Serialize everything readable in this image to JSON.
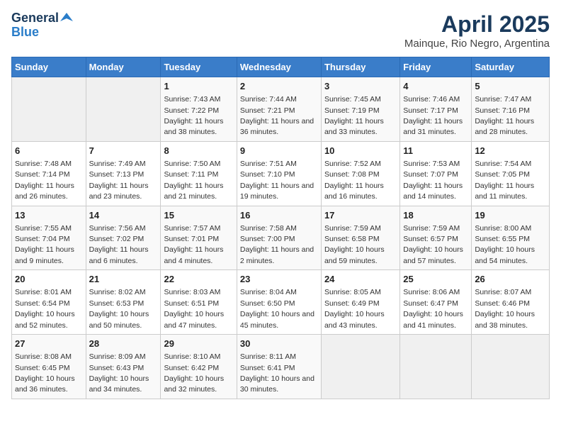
{
  "logo": {
    "general": "General",
    "blue": "Blue"
  },
  "title": "April 2025",
  "location": "Mainque, Rio Negro, Argentina",
  "weekdays": [
    "Sunday",
    "Monday",
    "Tuesday",
    "Wednesday",
    "Thursday",
    "Friday",
    "Saturday"
  ],
  "weeks": [
    [
      {
        "day": "",
        "info": "",
        "empty": true
      },
      {
        "day": "",
        "info": "",
        "empty": true
      },
      {
        "day": "1",
        "info": "Sunrise: 7:43 AM\nSunset: 7:22 PM\nDaylight: 11 hours and 38 minutes."
      },
      {
        "day": "2",
        "info": "Sunrise: 7:44 AM\nSunset: 7:21 PM\nDaylight: 11 hours and 36 minutes."
      },
      {
        "day": "3",
        "info": "Sunrise: 7:45 AM\nSunset: 7:19 PM\nDaylight: 11 hours and 33 minutes."
      },
      {
        "day": "4",
        "info": "Sunrise: 7:46 AM\nSunset: 7:17 PM\nDaylight: 11 hours and 31 minutes."
      },
      {
        "day": "5",
        "info": "Sunrise: 7:47 AM\nSunset: 7:16 PM\nDaylight: 11 hours and 28 minutes."
      }
    ],
    [
      {
        "day": "6",
        "info": "Sunrise: 7:48 AM\nSunset: 7:14 PM\nDaylight: 11 hours and 26 minutes."
      },
      {
        "day": "7",
        "info": "Sunrise: 7:49 AM\nSunset: 7:13 PM\nDaylight: 11 hours and 23 minutes."
      },
      {
        "day": "8",
        "info": "Sunrise: 7:50 AM\nSunset: 7:11 PM\nDaylight: 11 hours and 21 minutes."
      },
      {
        "day": "9",
        "info": "Sunrise: 7:51 AM\nSunset: 7:10 PM\nDaylight: 11 hours and 19 minutes."
      },
      {
        "day": "10",
        "info": "Sunrise: 7:52 AM\nSunset: 7:08 PM\nDaylight: 11 hours and 16 minutes."
      },
      {
        "day": "11",
        "info": "Sunrise: 7:53 AM\nSunset: 7:07 PM\nDaylight: 11 hours and 14 minutes."
      },
      {
        "day": "12",
        "info": "Sunrise: 7:54 AM\nSunset: 7:05 PM\nDaylight: 11 hours and 11 minutes."
      }
    ],
    [
      {
        "day": "13",
        "info": "Sunrise: 7:55 AM\nSunset: 7:04 PM\nDaylight: 11 hours and 9 minutes."
      },
      {
        "day": "14",
        "info": "Sunrise: 7:56 AM\nSunset: 7:02 PM\nDaylight: 11 hours and 6 minutes."
      },
      {
        "day": "15",
        "info": "Sunrise: 7:57 AM\nSunset: 7:01 PM\nDaylight: 11 hours and 4 minutes."
      },
      {
        "day": "16",
        "info": "Sunrise: 7:58 AM\nSunset: 7:00 PM\nDaylight: 11 hours and 2 minutes."
      },
      {
        "day": "17",
        "info": "Sunrise: 7:59 AM\nSunset: 6:58 PM\nDaylight: 10 hours and 59 minutes."
      },
      {
        "day": "18",
        "info": "Sunrise: 7:59 AM\nSunset: 6:57 PM\nDaylight: 10 hours and 57 minutes."
      },
      {
        "day": "19",
        "info": "Sunrise: 8:00 AM\nSunset: 6:55 PM\nDaylight: 10 hours and 54 minutes."
      }
    ],
    [
      {
        "day": "20",
        "info": "Sunrise: 8:01 AM\nSunset: 6:54 PM\nDaylight: 10 hours and 52 minutes."
      },
      {
        "day": "21",
        "info": "Sunrise: 8:02 AM\nSunset: 6:53 PM\nDaylight: 10 hours and 50 minutes."
      },
      {
        "day": "22",
        "info": "Sunrise: 8:03 AM\nSunset: 6:51 PM\nDaylight: 10 hours and 47 minutes."
      },
      {
        "day": "23",
        "info": "Sunrise: 8:04 AM\nSunset: 6:50 PM\nDaylight: 10 hours and 45 minutes."
      },
      {
        "day": "24",
        "info": "Sunrise: 8:05 AM\nSunset: 6:49 PM\nDaylight: 10 hours and 43 minutes."
      },
      {
        "day": "25",
        "info": "Sunrise: 8:06 AM\nSunset: 6:47 PM\nDaylight: 10 hours and 41 minutes."
      },
      {
        "day": "26",
        "info": "Sunrise: 8:07 AM\nSunset: 6:46 PM\nDaylight: 10 hours and 38 minutes."
      }
    ],
    [
      {
        "day": "27",
        "info": "Sunrise: 8:08 AM\nSunset: 6:45 PM\nDaylight: 10 hours and 36 minutes."
      },
      {
        "day": "28",
        "info": "Sunrise: 8:09 AM\nSunset: 6:43 PM\nDaylight: 10 hours and 34 minutes."
      },
      {
        "day": "29",
        "info": "Sunrise: 8:10 AM\nSunset: 6:42 PM\nDaylight: 10 hours and 32 minutes."
      },
      {
        "day": "30",
        "info": "Sunrise: 8:11 AM\nSunset: 6:41 PM\nDaylight: 10 hours and 30 minutes."
      },
      {
        "day": "",
        "info": "",
        "empty": true
      },
      {
        "day": "",
        "info": "",
        "empty": true
      },
      {
        "day": "",
        "info": "",
        "empty": true
      }
    ]
  ]
}
